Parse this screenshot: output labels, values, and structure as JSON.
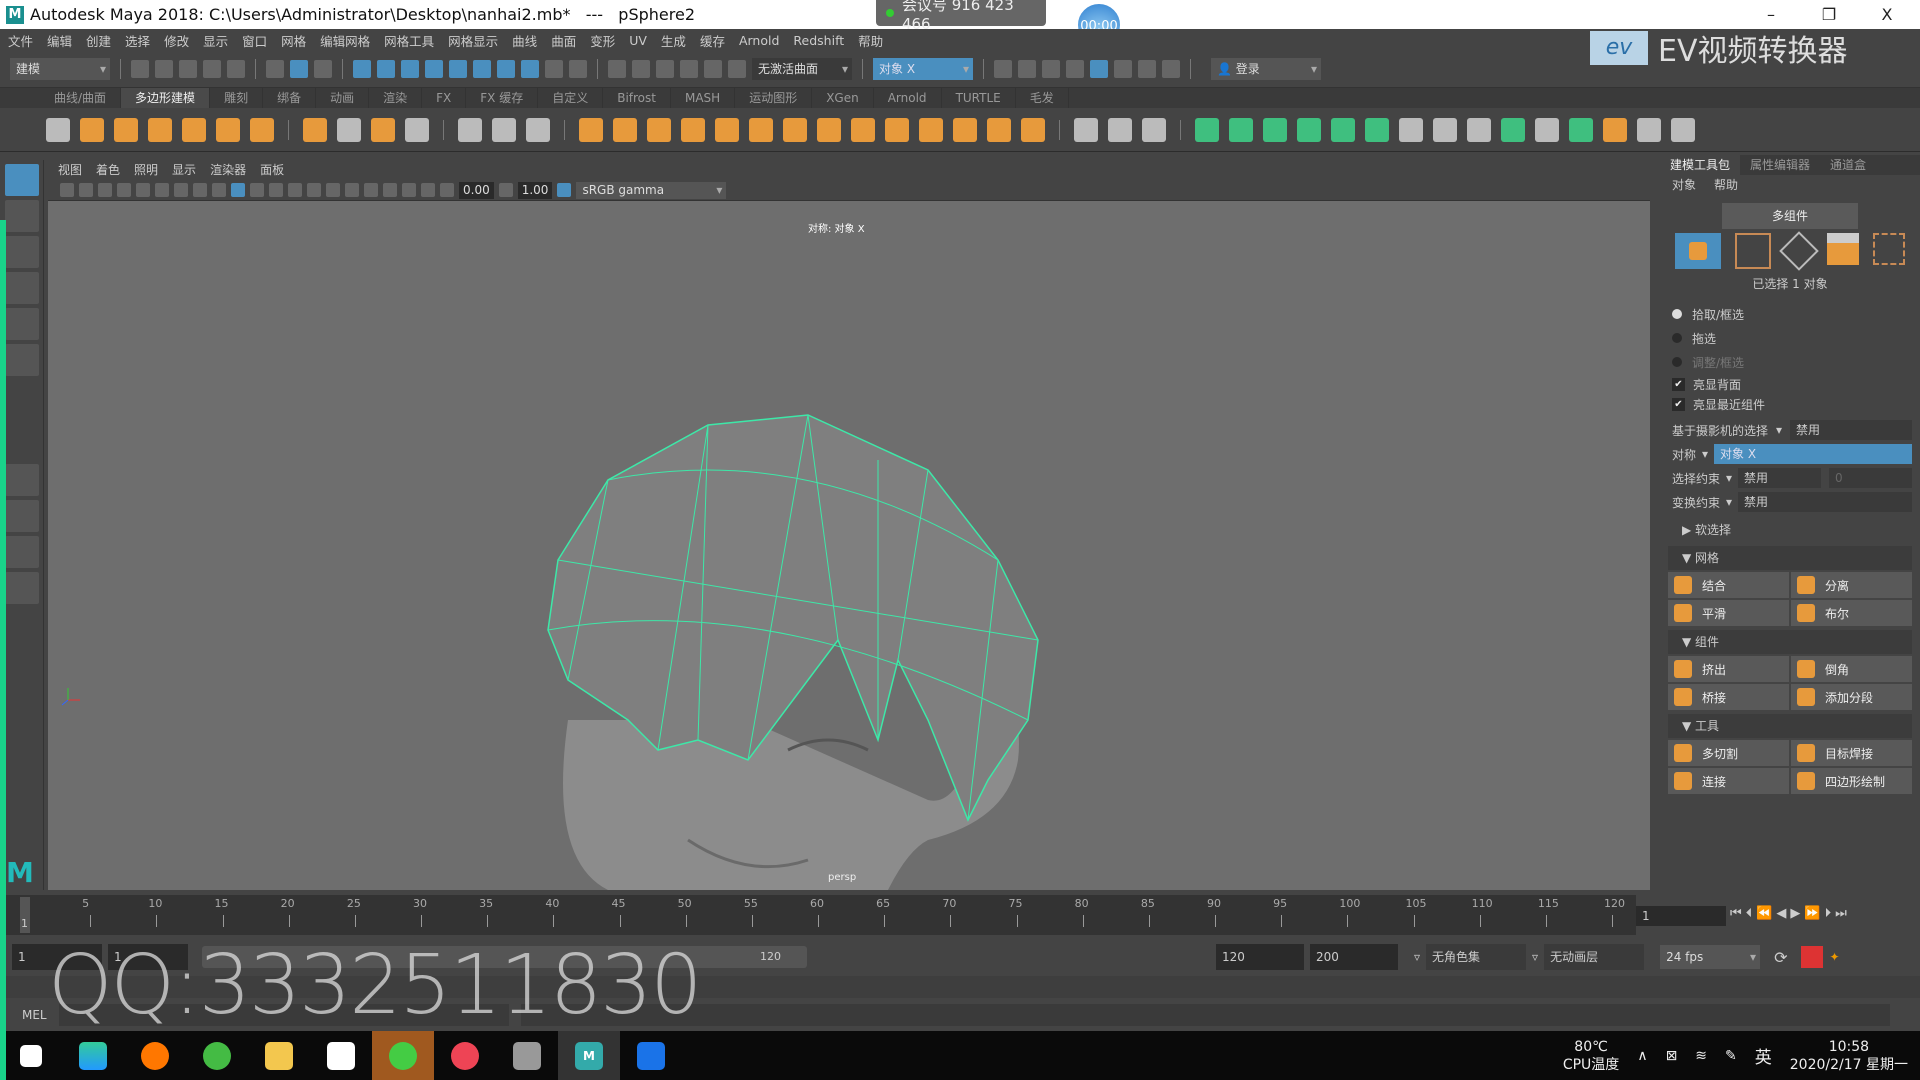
{
  "window": {
    "title": "Autodesk Maya 2018: C:\\Users\\Administrator\\Desktop\\nanhai2.mb*   ---   pSphere2",
    "minimize": "–",
    "maximize": "❐",
    "close": "X"
  },
  "overlay": {
    "meeting": "会议号 916 423 466",
    "timer": "00:00",
    "ev_brand": "EV视频转换器",
    "ev_logo": "ev",
    "watermark": "QQ:3332511830"
  },
  "menu": [
    "文件",
    "编辑",
    "创建",
    "选择",
    "修改",
    "显示",
    "窗口",
    "网格",
    "编辑网格",
    "网格工具",
    "网格显示",
    "曲线",
    "曲面",
    "变形",
    "UV",
    "生成",
    "缓存",
    "Arnold",
    "Redshift",
    "帮助"
  ],
  "status": {
    "mode": "建模",
    "live_surface": "无激活曲面",
    "symmetry": "对象 X",
    "login": "登录"
  },
  "shelf_tabs": [
    "曲线/曲面",
    "多边形建模",
    "雕刻",
    "绑备",
    "动画",
    "渲染",
    "FX",
    "FX 缓存",
    "自定义",
    "Bifrost",
    "MASH",
    "运动图形",
    "XGen",
    "Arnold",
    "TURTLE",
    "毛发"
  ],
  "shelf_active": 1,
  "viewport": {
    "menu": [
      "视图",
      "着色",
      "照明",
      "显示",
      "渲染器",
      "面板"
    ],
    "exposure": "0.00",
    "gamma": "1.00",
    "colorspace": "sRGB gamma",
    "info": "对称: 对象 X",
    "camera": "persp"
  },
  "right_panel": {
    "tabs": [
      "建模工具包",
      "属性编辑器",
      "通道盒"
    ],
    "menu": [
      "对象",
      "帮助"
    ],
    "multi_component": "多组件",
    "selected": "已选择 1 对象",
    "select_modes": [
      {
        "label": "拾取/框选",
        "on": true
      },
      {
        "label": "拖选",
        "on": false
      },
      {
        "label": "调整/框选",
        "on": false
      }
    ],
    "checks": [
      {
        "label": "亮显背面",
        "checked": true
      },
      {
        "label": "亮显最近组件",
        "checked": true
      }
    ],
    "camera_select": {
      "label": "基于摄影机的选择",
      "value": "禁用"
    },
    "symmetry": {
      "label": "对称",
      "value": "对象 X"
    },
    "select_constraint": {
      "label": "选择约束",
      "value": "禁用",
      "num": "0"
    },
    "transform_constraint": {
      "label": "变换约束",
      "value": "禁用"
    },
    "soft_select": "软选择",
    "sections": [
      {
        "title": "网格",
        "buttons": [
          "结合",
          "分离",
          "平滑",
          "布尔"
        ]
      },
      {
        "title": "组件",
        "buttons": [
          "挤出",
          "倒角",
          "桥接",
          "添加分段"
        ]
      },
      {
        "title": "工具",
        "buttons": [
          "多切割",
          "目标焊接",
          "连接",
          "四边形绘制"
        ]
      }
    ]
  },
  "timeline": {
    "ticks": [
      "5",
      "10",
      "15",
      "20",
      "25",
      "30",
      "35",
      "40",
      "45",
      "50",
      "55",
      "60",
      "65",
      "70",
      "75",
      "80",
      "85",
      "90",
      "95",
      "100",
      "105",
      "110",
      "115",
      "120"
    ],
    "current": "1",
    "start_marker": "1"
  },
  "range": {
    "start": "1",
    "playback_start": "1",
    "slider_end": "120",
    "end": "120",
    "anim_end": "200",
    "character_set": "无角色集",
    "anim_layer": "无动画层",
    "fps": "24 fps"
  },
  "command": {
    "label": "MEL"
  },
  "taskbar": {
    "cpu_temp": "80℃",
    "cpu_label": "CPU温度",
    "ime": "英",
    "time": "10:58",
    "date": "2020/2/17 星期一"
  },
  "colors": {
    "accent": "#4a8fbf",
    "wire": "#3de8a8",
    "orange": "#e79a3c"
  }
}
